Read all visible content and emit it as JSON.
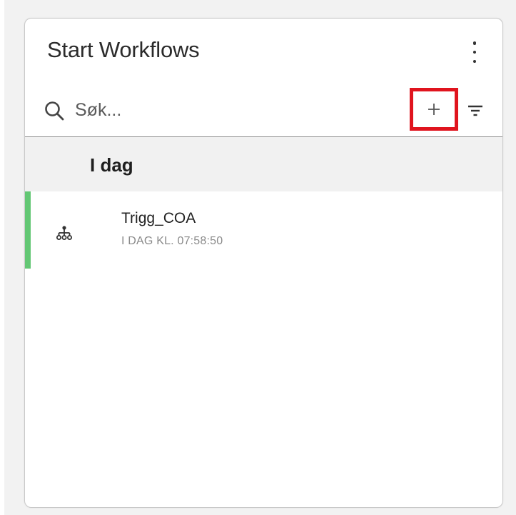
{
  "panel": {
    "title": "Start Workflows",
    "menu_icon": "kebab-menu-icon"
  },
  "search": {
    "placeholder": "Søk...",
    "value": "",
    "icon": "search-icon"
  },
  "toolbar": {
    "add_label": "+",
    "add_icon": "plus-icon",
    "filter_icon": "filter-icon",
    "highlight_color": "#e0141e"
  },
  "groups": [
    {
      "label": "I dag",
      "items": [
        {
          "name": "Trigg_COA",
          "timestamp": "I DAG KL.  07:58:50",
          "icon": "workflow-hierarchy-icon",
          "status_color": "#63c774"
        }
      ]
    }
  ]
}
